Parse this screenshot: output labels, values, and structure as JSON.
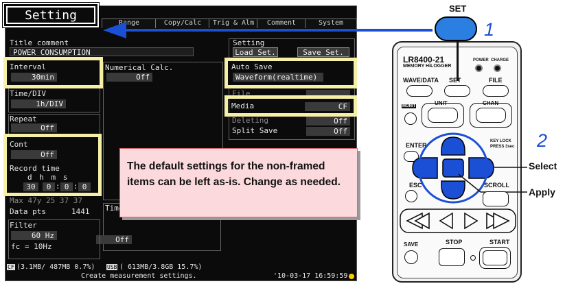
{
  "screen": {
    "title_tab": "Setting",
    "tabs": [
      "Range",
      "Copy/Calc",
      "Trig & Alm",
      "Comment",
      "System"
    ],
    "title_comment_label": "Title comment",
    "title_comment_value": "POWER CONSUMPTION",
    "setting_label": "Setting",
    "load_button": "Load Set.",
    "save_button": "Save Set.",
    "interval_label": "Interval",
    "interval_value": "30min",
    "numerical_calc_label": "Numerical Calc.",
    "numerical_calc_value": "Off",
    "auto_save_label": "Auto Save",
    "auto_save_value": "Waveform(realtime)",
    "time_div_label": "Time/DIV",
    "time_div_value": "1h/DIV",
    "file_label": "File",
    "media_label": "Media",
    "media_value": "CF",
    "repeat_label": "Repeat",
    "repeat_value": "Off",
    "deleting_label": "Deleting",
    "deleting_value": "Off",
    "split_save_label": "Split Save",
    "split_save_value": "Off",
    "cont_label": "Cont",
    "cont_value": "Off",
    "record_time_label": "Record time",
    "record_time_units": "d  h  m  s",
    "record_time_values": [
      "30",
      "0",
      "0",
      "0"
    ],
    "max_line": "Max 47y 25 37 37",
    "data_pts_label": "Data pts",
    "data_pts_value": "1441",
    "time_label": "Time",
    "time_value": "Off",
    "filter_label": "Filter",
    "filter_value": "60 Hz",
    "fc_value": "fc = 10Hz",
    "cf_status": "(3.1MB/ 487MB  0.7%)",
    "cf_tag": "CF",
    "usb_status": "( 613MB/3.8GB 15.7%)",
    "usb_tag": "USB",
    "status_message": "Create measurement settings.",
    "clock": "'10-03-17 16:59:59"
  },
  "callout": {
    "text": "The default settings for the non-framed items can be left as-is. Change as needed."
  },
  "device": {
    "set_label": "SET",
    "step1": "1",
    "step2": "2",
    "select_label": "Select",
    "apply_label": "Apply",
    "model": "LR8400-21",
    "model_sub": "MEMORY HiLOGGER",
    "power_label": "POWER",
    "charge_label": "CHARGE",
    "wave_data": "WAVE/DATA",
    "set_btn": "SET",
    "file_btn": "FILE",
    "monit": "MONIT",
    "unit": "UNIT",
    "chan": "CHAN",
    "enter": "ENTER",
    "key_lock": "KEY LOCK",
    "press_3sec": "PRESS 3sec",
    "esc": "ESC",
    "scroll": "SCROLL",
    "save": "SAVE",
    "stop": "STOP",
    "start": "START"
  },
  "colors": {
    "highlight_frame": "#f6f0a6",
    "callout_fill": "#fcd9dc",
    "callout_border": "#d96a72",
    "arrow_blue": "#1a4fd6",
    "set_button_blue": "#2a7fe0"
  }
}
